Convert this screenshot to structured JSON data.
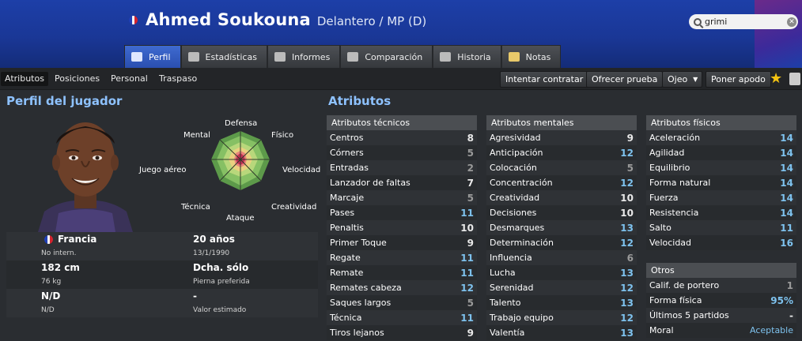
{
  "header": {
    "player_name": "Ahmed Soukouna",
    "position": "Delantero / MP (D)",
    "search_value": "grimi"
  },
  "tabs": [
    {
      "label": "Perfil",
      "active": true
    },
    {
      "label": "Estadísticas"
    },
    {
      "label": "Informes"
    },
    {
      "label": "Comparación"
    },
    {
      "label": "Historia"
    },
    {
      "label": "Notas"
    }
  ],
  "subtabs": [
    {
      "label": "Atributos",
      "active": true
    },
    {
      "label": "Posiciones"
    },
    {
      "label": "Personal"
    },
    {
      "label": "Traspaso"
    }
  ],
  "actions": {
    "contract": "Intentar contratar",
    "trial": "Ofrecer prueba",
    "scout": "Ojeo",
    "nickname": "Poner apodo"
  },
  "profile": {
    "title": "Perfil del jugador",
    "radar_labels": {
      "defensa": "Defensa",
      "fisico": "Físico",
      "velocidad": "Velocidad",
      "creatividad": "Creatividad",
      "ataque": "Ataque",
      "tecnica": "Técnica",
      "juego_aereo": "Juego aéreo",
      "mental": "Mental"
    },
    "nationality": "Francia",
    "intl": "No intern.",
    "age": "20 años",
    "dob": "13/1/1990",
    "height": "182 cm",
    "weight": "76 kg",
    "foot": "Dcha. sólo",
    "foot_label": "Pierna preferida",
    "reputation": "N/D",
    "reputation_sub": "N/D",
    "value": "-",
    "value_label": "Valor estimado"
  },
  "attributes": {
    "title": "Atributos",
    "technical": {
      "title": "Atributos técnicos",
      "rows": [
        {
          "name": "Centros",
          "value": "8"
        },
        {
          "name": "Córners",
          "value": "5"
        },
        {
          "name": "Entradas",
          "value": "2"
        },
        {
          "name": "Lanzador de faltas",
          "value": "7"
        },
        {
          "name": "Marcaje",
          "value": "5"
        },
        {
          "name": "Pases",
          "value": "11"
        },
        {
          "name": "Penaltis",
          "value": "10"
        },
        {
          "name": "Primer Toque",
          "value": "9"
        },
        {
          "name": "Regate",
          "value": "11"
        },
        {
          "name": "Remate",
          "value": "11"
        },
        {
          "name": "Remates cabeza",
          "value": "12"
        },
        {
          "name": "Saques largos",
          "value": "5"
        },
        {
          "name": "Técnica",
          "value": "11"
        },
        {
          "name": "Tiros lejanos",
          "value": "9"
        }
      ]
    },
    "mental": {
      "title": "Atributos mentales",
      "rows": [
        {
          "name": "Agresividad",
          "value": "9"
        },
        {
          "name": "Anticipación",
          "value": "12"
        },
        {
          "name": "Colocación",
          "value": "5"
        },
        {
          "name": "Concentración",
          "value": "12"
        },
        {
          "name": "Creatividad",
          "value": "10"
        },
        {
          "name": "Decisiones",
          "value": "10"
        },
        {
          "name": "Desmarques",
          "value": "13"
        },
        {
          "name": "Determinación",
          "value": "12"
        },
        {
          "name": "Influencia",
          "value": "6"
        },
        {
          "name": "Lucha",
          "value": "13"
        },
        {
          "name": "Serenidad",
          "value": "12"
        },
        {
          "name": "Talento",
          "value": "13"
        },
        {
          "name": "Trabajo equipo",
          "value": "12"
        },
        {
          "name": "Valentía",
          "value": "13"
        }
      ]
    },
    "physical": {
      "title": "Atributos físicos",
      "rows": [
        {
          "name": "Aceleración",
          "value": "14"
        },
        {
          "name": "Agilidad",
          "value": "14"
        },
        {
          "name": "Equilibrio",
          "value": "14"
        },
        {
          "name": "Forma natural",
          "value": "14"
        },
        {
          "name": "Fuerza",
          "value": "14"
        },
        {
          "name": "Resistencia",
          "value": "14"
        },
        {
          "name": "Salto",
          "value": "11"
        },
        {
          "name": "Velocidad",
          "value": "16"
        }
      ]
    },
    "others": {
      "title": "Otros",
      "rows": [
        {
          "name": "Calif. de portero",
          "value": "1"
        },
        {
          "name": "Forma física",
          "value": "95%"
        },
        {
          "name": "Últimos 5 partidos",
          "value": "-"
        },
        {
          "name": "Moral",
          "value": "Aceptable"
        }
      ]
    }
  }
}
